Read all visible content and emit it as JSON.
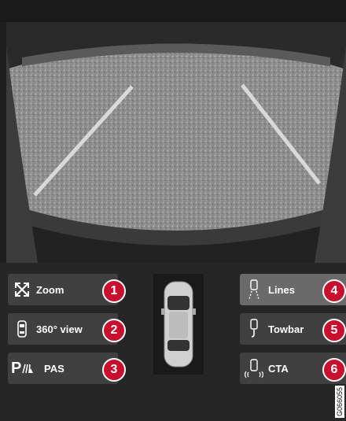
{
  "buttons": [
    {
      "key": "zoom",
      "label": "Zoom",
      "number": "1",
      "icon": "zoom-arrows-icon"
    },
    {
      "key": "360",
      "label": "360° view",
      "number": "2",
      "icon": "car-top-icon"
    },
    {
      "key": "pas",
      "label": "PAS",
      "number": "3",
      "icon": "parking-assist-icon",
      "icon_text": "P"
    },
    {
      "key": "lines",
      "label": "Lines",
      "number": "4",
      "icon": "guide-lines-icon",
      "active": true
    },
    {
      "key": "towbar",
      "label": "Towbar",
      "number": "5",
      "icon": "towbar-icon"
    },
    {
      "key": "cta",
      "label": "CTA",
      "number": "6",
      "icon": "cross-traffic-icon"
    }
  ],
  "figure_code": "G066055",
  "colors": {
    "badge": "#c8102e",
    "button": "#404040",
    "active_button": "#6a6a6a"
  }
}
